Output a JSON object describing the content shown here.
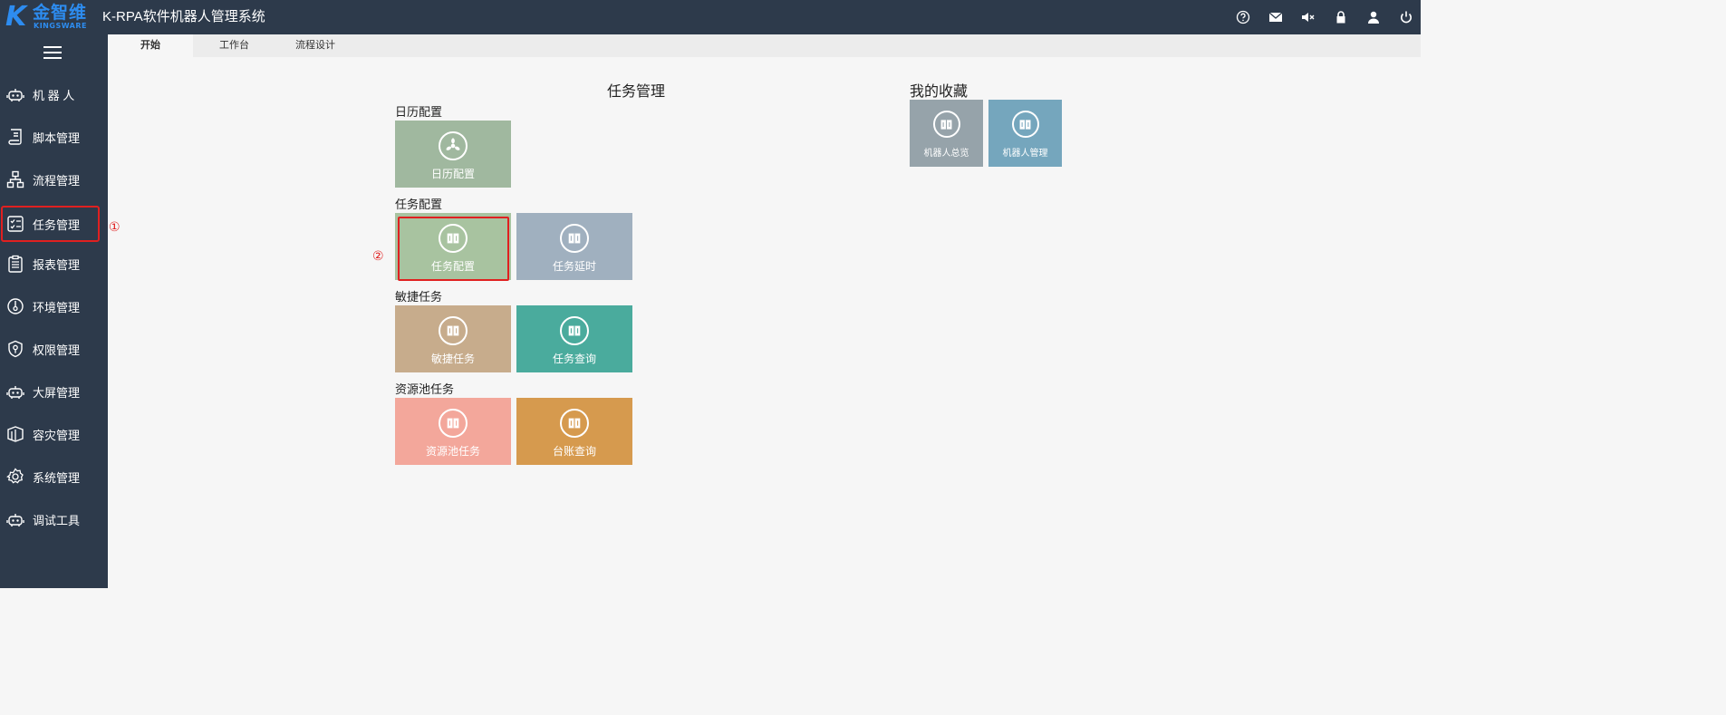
{
  "app": {
    "logo_k": "K",
    "logo_cn": "金智维",
    "logo_en": "KINGSWARE",
    "title": "K-RPA软件机器人管理系统"
  },
  "top_icons": [
    "help-icon",
    "mail-icon",
    "mute-icon",
    "lock-icon",
    "user-icon",
    "power-icon"
  ],
  "sidebar": {
    "items": [
      {
        "label": "机 器 人",
        "icon": "robot-icon"
      },
      {
        "label": "脚本管理",
        "icon": "script-icon"
      },
      {
        "label": "流程管理",
        "icon": "flow-icon"
      },
      {
        "label": "任务管理",
        "icon": "task-icon"
      },
      {
        "label": "报表管理",
        "icon": "report-icon"
      },
      {
        "label": "环境管理",
        "icon": "environment-icon"
      },
      {
        "label": "权限管理",
        "icon": "permission-icon"
      },
      {
        "label": "大屏管理",
        "icon": "robot-icon"
      },
      {
        "label": "容灾管理",
        "icon": "disaster-recovery-icon"
      },
      {
        "label": "系统管理",
        "icon": "settings-icon"
      },
      {
        "label": "调试工具",
        "icon": "robot-icon"
      }
    ]
  },
  "annotations": {
    "first": "①",
    "second": "②"
  },
  "tabs": [
    {
      "label": "开始",
      "active": true
    },
    {
      "label": "工作台",
      "active": false
    },
    {
      "label": "流程设计",
      "active": false
    }
  ],
  "task_mgmt": {
    "title": "任务管理",
    "groups": [
      {
        "label": "日历配置",
        "tiles": [
          {
            "label": "日历配置",
            "color": "#a0b89f",
            "icon": "calendar-fan-icon"
          }
        ]
      },
      {
        "label": "任务配置",
        "tiles": [
          {
            "label": "任务配置",
            "color": "#a8c3a0",
            "icon": "book-icon"
          },
          {
            "label": "任务延时",
            "color": "#a0b0bf",
            "icon": "book-icon"
          }
        ]
      },
      {
        "label": "敏捷任务",
        "tiles": [
          {
            "label": "敏捷任务",
            "color": "#c7ac8c",
            "icon": "book-icon"
          },
          {
            "label": "任务查询",
            "color": "#4aab9d",
            "icon": "book-icon"
          }
        ]
      },
      {
        "label": "资源池任务",
        "tiles": [
          {
            "label": "资源池任务",
            "color": "#f3a79b",
            "icon": "book-icon"
          },
          {
            "label": "台账查询",
            "color": "#d69a4e",
            "icon": "book-icon"
          }
        ]
      }
    ]
  },
  "favorites": {
    "title": "我的收藏",
    "tiles": [
      {
        "label": "机器人总览",
        "color": "#96a3aa",
        "icon": "book-icon"
      },
      {
        "label": "机器人管理",
        "color": "#75a6bd",
        "icon": "book-icon"
      }
    ]
  },
  "colors": {
    "topbar": "#2d3a4b",
    "accent_blue": "#2d8cf0",
    "highlight_red": "#e02020"
  }
}
